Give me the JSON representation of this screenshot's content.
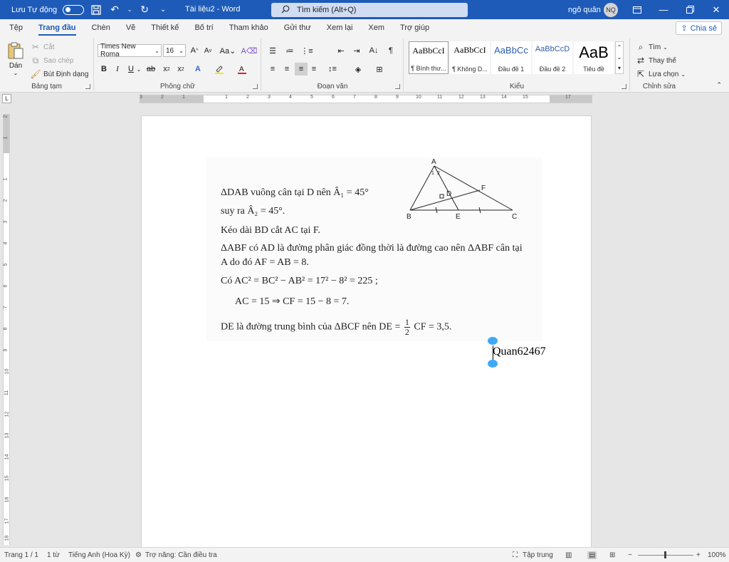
{
  "titlebar": {
    "autosave_label": "Lưu Tự động",
    "doc_title": "Tài liệu2  -  Word",
    "search_placeholder": "Tìm kiếm (Alt+Q)",
    "user_name": "ngô quân",
    "user_initials": "NQ",
    "accent": "#1e5bb8"
  },
  "tabs": [
    "Tệp",
    "Trang đầu",
    "Chèn",
    "Vẽ",
    "Thiết kế",
    "Bố trí",
    "Tham khảo",
    "Gửi thư",
    "Xem lại",
    "Xem",
    "Trợ giúp"
  ],
  "active_tab": "Trang đầu",
  "share_label": "Chia sẻ",
  "clipboard": {
    "paste": "Dán",
    "cut": "Cắt",
    "copy": "Sao chép",
    "format_painter": "Bút Định dạng",
    "label": "Bảng tạm"
  },
  "font": {
    "name": "Times New Roma",
    "size": "16",
    "label": "Phông chữ"
  },
  "paragraph": {
    "label": "Đoạn văn"
  },
  "styles": {
    "label": "Kiểu",
    "items": [
      {
        "sample": "AaBbCcI",
        "name": "¶ Bình thư..."
      },
      {
        "sample": "AaBbCcI",
        "name": "¶ Không D..."
      },
      {
        "sample": "AaBbCc",
        "name": "Đầu đề 1"
      },
      {
        "sample": "AaBbCcD",
        "name": "Đầu đề 2"
      },
      {
        "sample": "AaB",
        "name": "Tiêu đề"
      }
    ]
  },
  "editing": {
    "find": "Tìm",
    "replace": "Thay thế",
    "select": "Lựa chọn",
    "label": "Chỉnh sửa"
  },
  "ruler": {
    "h_numbers": [
      "3",
      "2",
      "1",
      "1",
      "2",
      "3",
      "4",
      "5",
      "6",
      "7",
      "8",
      "9",
      "10",
      "11",
      "12",
      "13",
      "14",
      "15",
      "17"
    ],
    "v_numbers": [
      "2",
      "1",
      "1",
      "2",
      "3",
      "4",
      "5",
      "6",
      "7",
      "8",
      "9",
      "10",
      "11",
      "12",
      "13",
      "14",
      "15",
      "16",
      "17",
      "18"
    ]
  },
  "document": {
    "lines": [
      "ΔDAB vuông cân tại D nên  Â₁ = 45°",
      "suy ra  Â₂ = 45°.",
      "Kéo dài BD cắt AC tại F.",
      "ΔABF có AD là đường phân giác đồng thời là đường cao nên ΔABF cân tại",
      "A do đó AF = AB = 8.",
      "Có AC² = BC² − AB² = 17² − 8² = 225 ;",
      "AC = 15 ⇒ CF = 15 − 8 = 7.",
      "DE là đường trung bình của ΔBCF nên DE =",
      "CF = 3,5."
    ],
    "frac_num": "1",
    "frac_den": "2",
    "figure_labels": {
      "A": "A",
      "B": "B",
      "C": "C",
      "D": "D",
      "E": "E",
      "F": "F",
      "a1": "1",
      "a2": "2"
    },
    "typed_text": "Quan62467"
  },
  "status": {
    "page": "Trang 1 / 1",
    "words": "1 từ",
    "language": "Tiếng Anh (Hoa Kỳ)",
    "accessibility": "Trợ năng: Cần điều tra",
    "focus": "Tập trung",
    "zoom": "100%",
    "zoom_level": 1.0
  }
}
